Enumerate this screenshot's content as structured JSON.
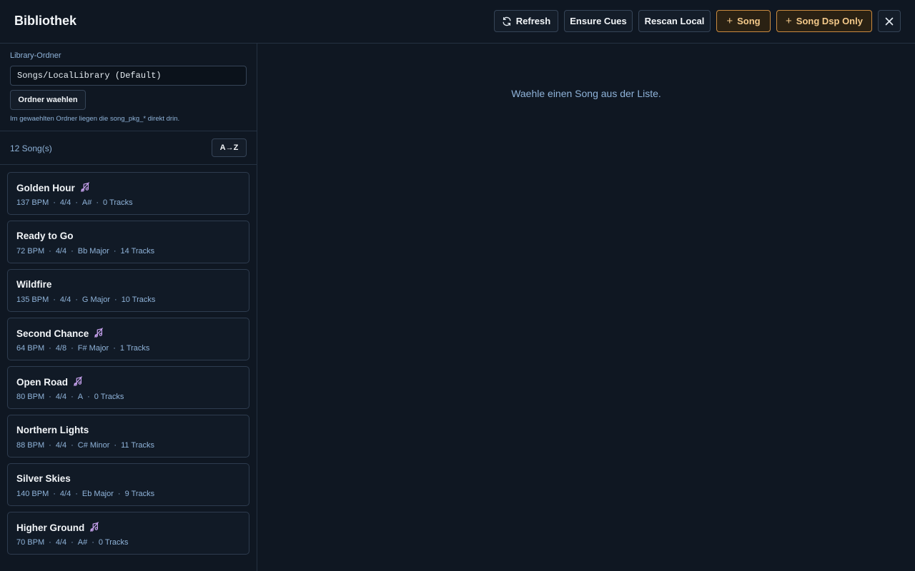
{
  "header": {
    "title": "Bibliothek",
    "buttons": {
      "refresh": "Refresh",
      "ensure_cues": "Ensure Cues",
      "rescan_local": "Rescan Local",
      "add_song": "Song",
      "add_song_dsp": "Song Dsp Only"
    },
    "icons": {
      "refresh": "refresh-icon",
      "plus": "plus-icon",
      "close": "close-icon"
    },
    "accent_color": "#f4c98a"
  },
  "sidebar": {
    "folder_label": "Library-Ordner",
    "folder_value": "Songs/LocalLibrary (Default)",
    "choose_folder": "Ordner waehlen",
    "hint": "Im gewaehlten Ordner liegen die song_pkg_* direkt drin.",
    "song_count": "12 Song(s)",
    "sort_label": "A→Z",
    "songs": [
      {
        "title": "Golden Hour",
        "dsp": true,
        "bpm": "137 BPM",
        "meter": "4/4",
        "key": "A#",
        "tracks": "0 Tracks"
      },
      {
        "title": "Ready to Go",
        "dsp": false,
        "bpm": "72 BPM",
        "meter": "4/4",
        "key": "Bb Major",
        "tracks": "14 Tracks"
      },
      {
        "title": "Wildfire",
        "dsp": false,
        "bpm": "135 BPM",
        "meter": "4/4",
        "key": "G Major",
        "tracks": "10 Tracks"
      },
      {
        "title": "Second Chance",
        "dsp": true,
        "bpm": "64 BPM",
        "meter": "4/8",
        "key": "F# Major",
        "tracks": "1 Tracks"
      },
      {
        "title": "Open Road",
        "dsp": true,
        "bpm": "80 BPM",
        "meter": "4/4",
        "key": "A",
        "tracks": "0 Tracks"
      },
      {
        "title": "Northern Lights",
        "dsp": false,
        "bpm": "88 BPM",
        "meter": "4/4",
        "key": "C# Minor",
        "tracks": "11 Tracks"
      },
      {
        "title": "Silver Skies",
        "dsp": false,
        "bpm": "140 BPM",
        "meter": "4/4",
        "key": "Eb Major",
        "tracks": "9 Tracks"
      },
      {
        "title": "Higher Ground",
        "dsp": true,
        "bpm": "70 BPM",
        "meter": "4/4",
        "key": "A#",
        "tracks": "0 Tracks"
      }
    ]
  },
  "main": {
    "empty_message": "Waehle einen Song aus der Liste."
  }
}
